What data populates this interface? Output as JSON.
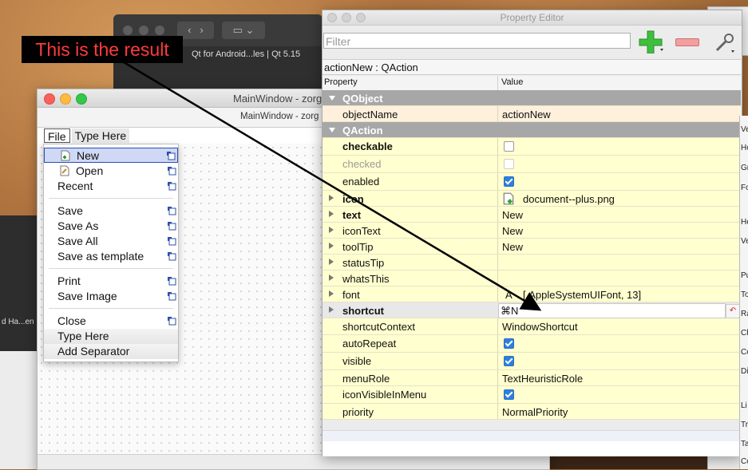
{
  "annotation": "This is the result",
  "qt_creator": {
    "title": "Qt for Android...les | Qt 5.15"
  },
  "background_app": {
    "text": "d Ha...en"
  },
  "main_window": {
    "title": "MainWindow - zorg",
    "subtitle": "MainWindow - zorg",
    "menubar": {
      "file": "File",
      "type_here": "Type Here"
    }
  },
  "file_menu": {
    "items": [
      {
        "label": "New",
        "selected": true,
        "icon": "document-plus-icon"
      },
      {
        "label": "Open",
        "icon": "document-open-icon"
      },
      {
        "label": "Recent"
      },
      {
        "label": "Save"
      },
      {
        "label": "Save As"
      },
      {
        "label": "Save All"
      },
      {
        "label": "Save as template"
      },
      {
        "label": "Print"
      },
      {
        "label": "Save Image"
      },
      {
        "label": "Close"
      },
      {
        "label": "Type Here"
      },
      {
        "label": "Add Separator"
      }
    ]
  },
  "property_editor": {
    "title": "Property Editor",
    "filter_placeholder": "Filter",
    "object_label": "actionNew : QAction",
    "columns": {
      "property": "Property",
      "value": "Value"
    },
    "groups": {
      "qobject": "QObject",
      "qaction": "QAction"
    },
    "rows": {
      "objectName": {
        "name": "objectName",
        "value": "actionNew"
      },
      "checkable": {
        "name": "checkable",
        "checked": false
      },
      "checked": {
        "name": "checked",
        "checked": false
      },
      "enabled": {
        "name": "enabled",
        "checked": true
      },
      "icon": {
        "name": "icon",
        "value": "document--plus.png"
      },
      "text": {
        "name": "text",
        "value": "New"
      },
      "iconText": {
        "name": "iconText",
        "value": "New"
      },
      "toolTip": {
        "name": "toolTip",
        "value": "New"
      },
      "statusTip": {
        "name": "statusTip",
        "value": ""
      },
      "whatsThis": {
        "name": "whatsThis",
        "value": ""
      },
      "font": {
        "name": "font",
        "value": "[.AppleSystemUIFont, 13]",
        "sample": "A"
      },
      "shortcut": {
        "name": "shortcut",
        "value": "⌘N"
      },
      "shortcutContext": {
        "name": "shortcutContext",
        "value": "WindowShortcut"
      },
      "autoRepeat": {
        "name": "autoRepeat",
        "checked": true
      },
      "visible": {
        "name": "visible",
        "checked": true
      },
      "menuRole": {
        "name": "menuRole",
        "value": "TextHeuristicRole"
      },
      "iconVisibleInMenu": {
        "name": "iconVisibleInMenu",
        "checked": true
      },
      "priority": {
        "name": "priority",
        "value": "NormalPriority"
      }
    }
  },
  "right_panel_fragments": [
    "Ve",
    "Ho",
    "Gr",
    "Fo",
    "He",
    "Ve",
    "Pu",
    "To",
    "Ra",
    "Ch",
    "Co",
    "Di",
    "Li",
    "Tr",
    "Ta",
    "Co"
  ],
  "colors": {
    "group_header": "#a7a7a7",
    "row_yellow": "#ffffcf",
    "row_peach": "#fff0dc",
    "accent_checkbox": "#2d7fe0",
    "annotation_text": "#ff3b3b"
  }
}
